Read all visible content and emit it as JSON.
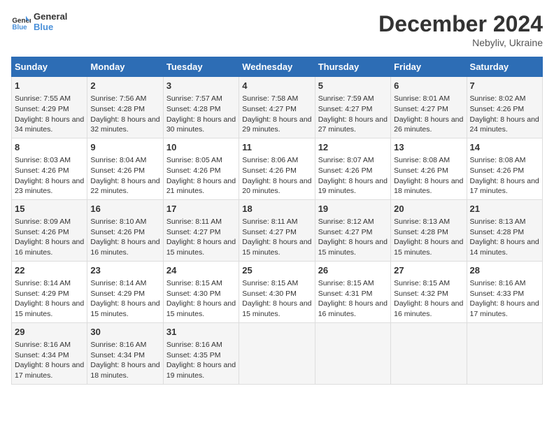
{
  "logo": {
    "text_general": "General",
    "text_blue": "Blue"
  },
  "title": "December 2024",
  "location": "Nebyliv, Ukraine",
  "days_of_week": [
    "Sunday",
    "Monday",
    "Tuesday",
    "Wednesday",
    "Thursday",
    "Friday",
    "Saturday"
  ],
  "weeks": [
    [
      {
        "day": "1",
        "sunrise": "7:55 AM",
        "sunset": "4:29 PM",
        "daylight": "8 hours and 34 minutes."
      },
      {
        "day": "2",
        "sunrise": "7:56 AM",
        "sunset": "4:28 PM",
        "daylight": "8 hours and 32 minutes."
      },
      {
        "day": "3",
        "sunrise": "7:57 AM",
        "sunset": "4:28 PM",
        "daylight": "8 hours and 30 minutes."
      },
      {
        "day": "4",
        "sunrise": "7:58 AM",
        "sunset": "4:27 PM",
        "daylight": "8 hours and 29 minutes."
      },
      {
        "day": "5",
        "sunrise": "7:59 AM",
        "sunset": "4:27 PM",
        "daylight": "8 hours and 27 minutes."
      },
      {
        "day": "6",
        "sunrise": "8:01 AM",
        "sunset": "4:27 PM",
        "daylight": "8 hours and 26 minutes."
      },
      {
        "day": "7",
        "sunrise": "8:02 AM",
        "sunset": "4:26 PM",
        "daylight": "8 hours and 24 minutes."
      }
    ],
    [
      {
        "day": "8",
        "sunrise": "8:03 AM",
        "sunset": "4:26 PM",
        "daylight": "8 hours and 23 minutes."
      },
      {
        "day": "9",
        "sunrise": "8:04 AM",
        "sunset": "4:26 PM",
        "daylight": "8 hours and 22 minutes."
      },
      {
        "day": "10",
        "sunrise": "8:05 AM",
        "sunset": "4:26 PM",
        "daylight": "8 hours and 21 minutes."
      },
      {
        "day": "11",
        "sunrise": "8:06 AM",
        "sunset": "4:26 PM",
        "daylight": "8 hours and 20 minutes."
      },
      {
        "day": "12",
        "sunrise": "8:07 AM",
        "sunset": "4:26 PM",
        "daylight": "8 hours and 19 minutes."
      },
      {
        "day": "13",
        "sunrise": "8:08 AM",
        "sunset": "4:26 PM",
        "daylight": "8 hours and 18 minutes."
      },
      {
        "day": "14",
        "sunrise": "8:08 AM",
        "sunset": "4:26 PM",
        "daylight": "8 hours and 17 minutes."
      }
    ],
    [
      {
        "day": "15",
        "sunrise": "8:09 AM",
        "sunset": "4:26 PM",
        "daylight": "8 hours and 16 minutes."
      },
      {
        "day": "16",
        "sunrise": "8:10 AM",
        "sunset": "4:26 PM",
        "daylight": "8 hours and 16 minutes."
      },
      {
        "day": "17",
        "sunrise": "8:11 AM",
        "sunset": "4:27 PM",
        "daylight": "8 hours and 15 minutes."
      },
      {
        "day": "18",
        "sunrise": "8:11 AM",
        "sunset": "4:27 PM",
        "daylight": "8 hours and 15 minutes."
      },
      {
        "day": "19",
        "sunrise": "8:12 AM",
        "sunset": "4:27 PM",
        "daylight": "8 hours and 15 minutes."
      },
      {
        "day": "20",
        "sunrise": "8:13 AM",
        "sunset": "4:28 PM",
        "daylight": "8 hours and 15 minutes."
      },
      {
        "day": "21",
        "sunrise": "8:13 AM",
        "sunset": "4:28 PM",
        "daylight": "8 hours and 14 minutes."
      }
    ],
    [
      {
        "day": "22",
        "sunrise": "8:14 AM",
        "sunset": "4:29 PM",
        "daylight": "8 hours and 15 minutes."
      },
      {
        "day": "23",
        "sunrise": "8:14 AM",
        "sunset": "4:29 PM",
        "daylight": "8 hours and 15 minutes."
      },
      {
        "day": "24",
        "sunrise": "8:15 AM",
        "sunset": "4:30 PM",
        "daylight": "8 hours and 15 minutes."
      },
      {
        "day": "25",
        "sunrise": "8:15 AM",
        "sunset": "4:30 PM",
        "daylight": "8 hours and 15 minutes."
      },
      {
        "day": "26",
        "sunrise": "8:15 AM",
        "sunset": "4:31 PM",
        "daylight": "8 hours and 16 minutes."
      },
      {
        "day": "27",
        "sunrise": "8:15 AM",
        "sunset": "4:32 PM",
        "daylight": "8 hours and 16 minutes."
      },
      {
        "day": "28",
        "sunrise": "8:16 AM",
        "sunset": "4:33 PM",
        "daylight": "8 hours and 17 minutes."
      }
    ],
    [
      {
        "day": "29",
        "sunrise": "8:16 AM",
        "sunset": "4:34 PM",
        "daylight": "8 hours and 17 minutes."
      },
      {
        "day": "30",
        "sunrise": "8:16 AM",
        "sunset": "4:34 PM",
        "daylight": "8 hours and 18 minutes."
      },
      {
        "day": "31",
        "sunrise": "8:16 AM",
        "sunset": "4:35 PM",
        "daylight": "8 hours and 19 minutes."
      },
      null,
      null,
      null,
      null
    ]
  ]
}
